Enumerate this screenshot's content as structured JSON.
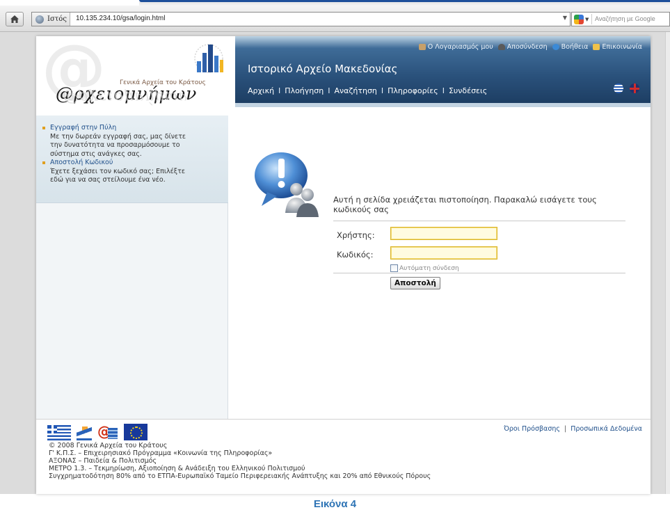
{
  "browser": {
    "site_identity": "Ιστός",
    "url": "10.135.234.10/gsa/login.html",
    "search_placeholder": "Αναζήτηση με Google"
  },
  "logo": {
    "small_text": "Γενικά Αρχεία του Κράτους",
    "wordmark": "@ρχειομνήμων"
  },
  "header": {
    "site_title": "Ιστορικό Αρχείο Μακεδονίας",
    "util_links": [
      "Ο Λογαριασμός μου",
      "Αποσύνδεση",
      "Βοήθεια",
      "Επικοινωνία"
    ],
    "nav": [
      "Αρχική",
      "Πλοήγηση",
      "Αναζήτηση",
      "Πληροφορίες",
      "Συνδέσεις"
    ],
    "nav_separator": "I"
  },
  "sidebar": {
    "items": [
      {
        "title": "Εγγραφή στην Πύλη",
        "text": "Με την δωρεάν εγγραφή σας, μας δίνετε την δυνατότητα να προσαρμόσουμε το σύστημα στις ανάγκες σας."
      },
      {
        "title": "Αποστολή Κωδικού",
        "text": "Έχετε ξεχάσει τον κωδικό σας; Επιλέξτε εδώ για να σας στείλουμε ένα νέο."
      }
    ]
  },
  "login": {
    "message": "Αυτή η σελίδα χρειάζεται πιστοποίηση. Παρακαλώ εισάγετε τους κωδικούς σας",
    "username_label": "Χρήστης:",
    "username_value": "",
    "password_label": "Κωδικός:",
    "password_value": "",
    "remember_label": "Αυτόματη σύνδεση",
    "remember_checked": false,
    "submit_label": "Αποστολή"
  },
  "footer": {
    "links": [
      "Όροι Πρόσβασης",
      "Προσωπικά Δεδομένα"
    ],
    "lines": [
      "© 2008 Γενικά Αρχεία του Κράτους",
      "Γ' Κ.Π.Σ. – Επιχειρησιακό Πρόγραμμα «Κοινωνία της Πληροφορίας»",
      "ΑΞΟΝΑΣ – Παιδεία & Πολιτισμός",
      "ΜΕΤΡΟ 1.3. – Τεκμηρίωση, Αξιοποίηση & Ανάδειξη του Ελληνικού Πολιτισμού",
      "Συγχρηματοδότηση 80% από το ΕΤΠΑ-Ευρωπαϊκό Ταμείο Περιφερειακής Ανάπτυξης και 20% από Εθνικούς Πόρους"
    ]
  },
  "caption": "Εικόνα 4",
  "colors": {
    "header_dark": "#1d3e63",
    "link_blue": "#1f4f8a",
    "caption_blue": "#2e74b5",
    "logo_red": "#d23318"
  }
}
